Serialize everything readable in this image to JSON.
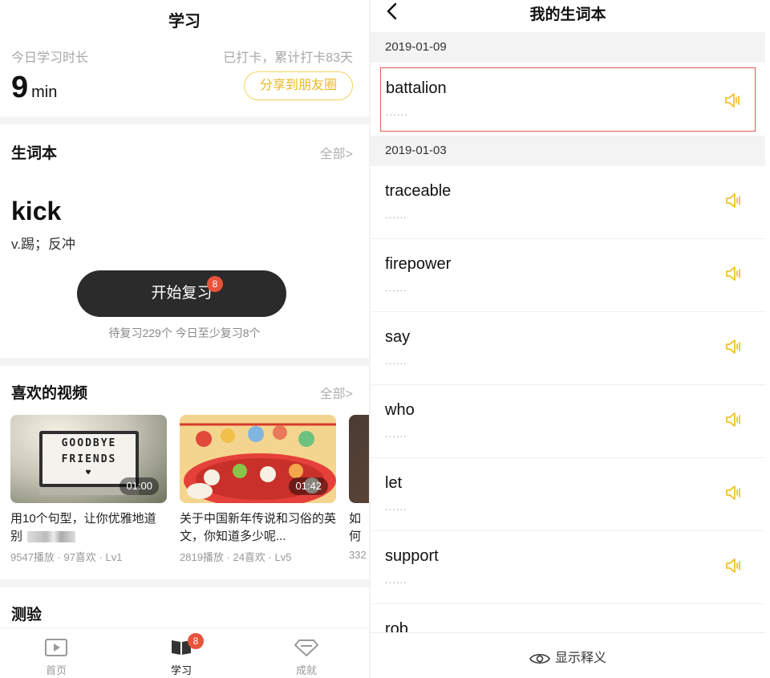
{
  "left": {
    "title": "学习",
    "study_label": "今日学习时长",
    "checkin_text": "已打卡，累计打卡83天",
    "minutes": "9",
    "minutes_unit": "min",
    "share_button": "分享到朋友圈",
    "vocab": {
      "title": "生词本",
      "more": "全部>",
      "word": "kick",
      "definition": "v.踢；反冲",
      "review_button": "开始复习",
      "review_badge": "8",
      "review_note": "待复习229个 今日至少复习8个"
    },
    "videos": {
      "title": "喜欢的视频",
      "more": "全部>",
      "items": [
        {
          "title": "用10个句型，让你优雅地道别",
          "duration": "01:00",
          "stats": "9547播放 · 97喜欢 · Lv1",
          "thumb_text_1": "GOODBYE",
          "thumb_text_2": "FRIENDS"
        },
        {
          "title": "关于中国新年传说和习俗的英文，你知道多少呢...",
          "duration": "01:42",
          "stats": "2819播放 · 24喜欢 · Lv5"
        },
        {
          "title": "如何时间",
          "stats": "332"
        }
      ]
    },
    "quiz": {
      "title": "测验"
    },
    "tabbar": {
      "home": "首页",
      "study": "学习",
      "study_badge": "8",
      "achievements": "成就"
    }
  },
  "right": {
    "title": "我的生词本",
    "groups": [
      {
        "date": "2019-01-09",
        "words": [
          "battalion"
        ]
      },
      {
        "date": "2019-01-03",
        "words": [
          "traceable",
          "firepower",
          "say",
          "who",
          "let",
          "support",
          "rob"
        ]
      }
    ],
    "placeholder": "......",
    "show_definitions": "显示释义"
  },
  "colors": {
    "accent_yellow": "#f2c230",
    "badge_red": "#e8533b",
    "dark_button": "#2b2b2b",
    "highlight_border": "#e35a55"
  }
}
